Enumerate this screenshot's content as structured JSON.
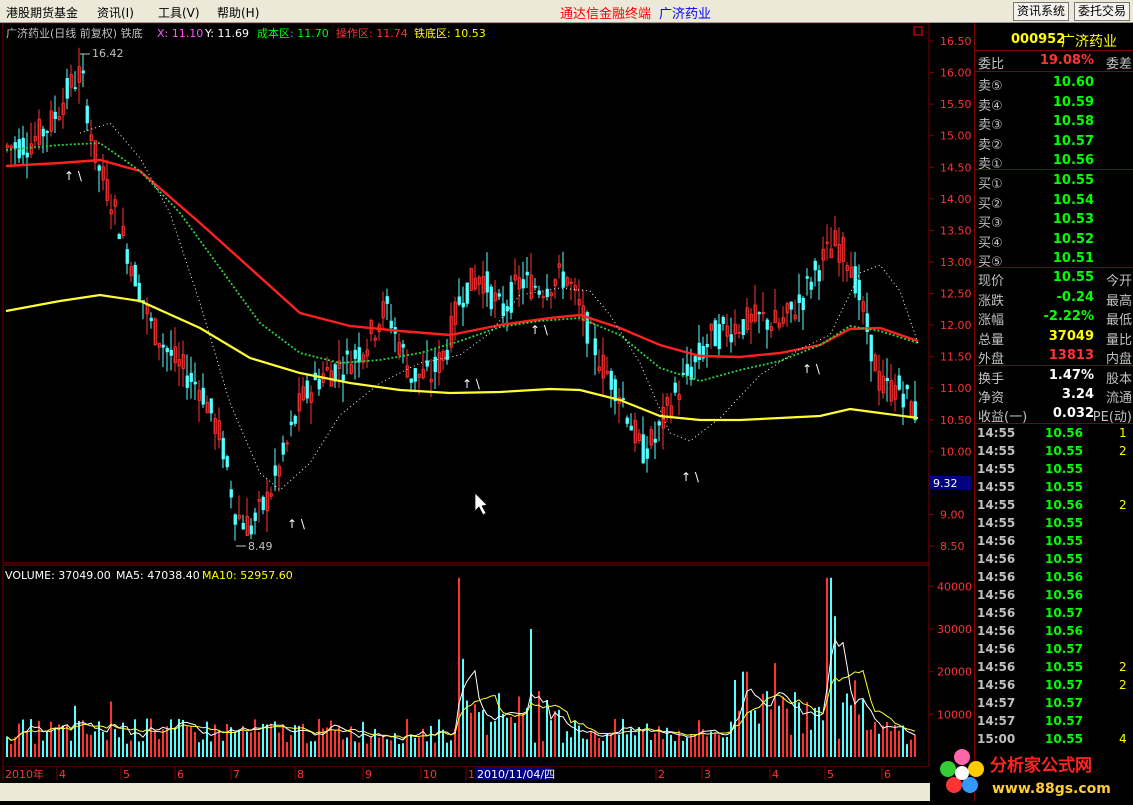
{
  "menu": {
    "items": [
      "港股期货基金",
      "资讯(I)",
      "工具(V)",
      "帮助(H)"
    ],
    "title": "通达信金融终端",
    "stock": "广济药业",
    "right_buttons": [
      "资讯系统",
      "委托交易"
    ]
  },
  "chart": {
    "title": "广济药业(日线 前复权) 铁底",
    "x_label": "X: 11.10",
    "y_label": "Y: 11.69",
    "cost_label": "成本区: 11.70",
    "op_label": "操作区: 11.74",
    "bottom_label": "铁底区: 10.53",
    "hi_mark": "16.42",
    "lo_mark": "8.49",
    "price_tag": "9.32"
  },
  "volume": {
    "label": "VOLUME: 37049.00",
    "ma5": "MA5: 47038.40",
    "ma10": "MA10: 52957.60"
  },
  "time_axis": {
    "labels": [
      "2010年",
      "4",
      "5",
      "6",
      "7",
      "8",
      "9",
      "10",
      "1",
      "2010/11/04/四",
      "2",
      "3",
      "4",
      "5",
      "6"
    ]
  },
  "chart_data": {
    "type": "candlestick",
    "ylim": [
      8.5,
      16.5
    ],
    "price_ticks": [
      "16.50",
      "16.00",
      "15.50",
      "15.00",
      "14.50",
      "14.00",
      "13.50",
      "13.00",
      "12.50",
      "12.00",
      "11.50",
      "11.00",
      "10.50",
      "10.00",
      "9.50",
      "9.00",
      "8.50"
    ],
    "volume_ticks": [
      "40000",
      "30000",
      "20000",
      "10000"
    ],
    "volume_ylim": [
      0,
      45000
    ]
  },
  "quote": {
    "code": "000952",
    "name": "广济药业",
    "weibi_label": "委比",
    "weibi": "19.08%",
    "weicha_label": "委差",
    "sells": [
      {
        "label": "卖⑤",
        "price": "10.60"
      },
      {
        "label": "卖④",
        "price": "10.59"
      },
      {
        "label": "卖③",
        "price": "10.58"
      },
      {
        "label": "卖②",
        "price": "10.57"
      },
      {
        "label": "卖①",
        "price": "10.56"
      }
    ],
    "buys": [
      {
        "label": "买①",
        "price": "10.55"
      },
      {
        "label": "买②",
        "price": "10.54"
      },
      {
        "label": "买③",
        "price": "10.53"
      },
      {
        "label": "买④",
        "price": "10.52"
      },
      {
        "label": "买⑤",
        "price": "10.51"
      }
    ],
    "stats": [
      {
        "label": "现价",
        "value": "10.55",
        "label2": "今开",
        "color": "#00ff00"
      },
      {
        "label": "涨跌",
        "value": "-0.24",
        "label2": "最高",
        "color": "#00ff00"
      },
      {
        "label": "涨幅",
        "value": "-2.22%",
        "label2": "最低",
        "color": "#00ff00"
      },
      {
        "label": "总量",
        "value": "37049",
        "label2": "量比",
        "color": "#ffff00"
      },
      {
        "label": "外盘",
        "value": "13813",
        "label2": "内盘",
        "color": "#ff3333"
      }
    ],
    "stats2": [
      {
        "label": "换手",
        "value": "1.47%",
        "label2": "股本",
        "color": "#ffffff"
      },
      {
        "label": "净资",
        "value": "3.24",
        "label2": "流通",
        "color": "#ffffff"
      },
      {
        "label": "收益(一)",
        "value": "0.032",
        "label2": "PE(动)",
        "color": "#ffffff"
      }
    ],
    "ticks": [
      {
        "t": "14:55",
        "p": "10.56",
        "v": "1"
      },
      {
        "t": "14:55",
        "p": "10.55",
        "v": "2"
      },
      {
        "t": "14:55",
        "p": "10.55",
        "v": ""
      },
      {
        "t": "14:55",
        "p": "10.55",
        "v": ""
      },
      {
        "t": "14:55",
        "p": "10.56",
        "v": "2"
      },
      {
        "t": "14:55",
        "p": "10.55",
        "v": ""
      },
      {
        "t": "14:56",
        "p": "10.55",
        "v": ""
      },
      {
        "t": "14:56",
        "p": "10.55",
        "v": ""
      },
      {
        "t": "14:56",
        "p": "10.56",
        "v": ""
      },
      {
        "t": "14:56",
        "p": "10.56",
        "v": ""
      },
      {
        "t": "14:56",
        "p": "10.57",
        "v": ""
      },
      {
        "t": "14:56",
        "p": "10.56",
        "v": ""
      },
      {
        "t": "14:56",
        "p": "10.57",
        "v": ""
      },
      {
        "t": "14:56",
        "p": "10.55",
        "v": "2"
      },
      {
        "t": "14:56",
        "p": "10.57",
        "v": "2"
      },
      {
        "t": "14:57",
        "p": "10.57",
        "v": ""
      },
      {
        "t": "14:57",
        "p": "10.57",
        "v": ""
      },
      {
        "t": "15:00",
        "p": "10.55",
        "v": "4"
      }
    ]
  },
  "logo": {
    "cn": "分析家公式网",
    "url": "www.88gs.com"
  }
}
